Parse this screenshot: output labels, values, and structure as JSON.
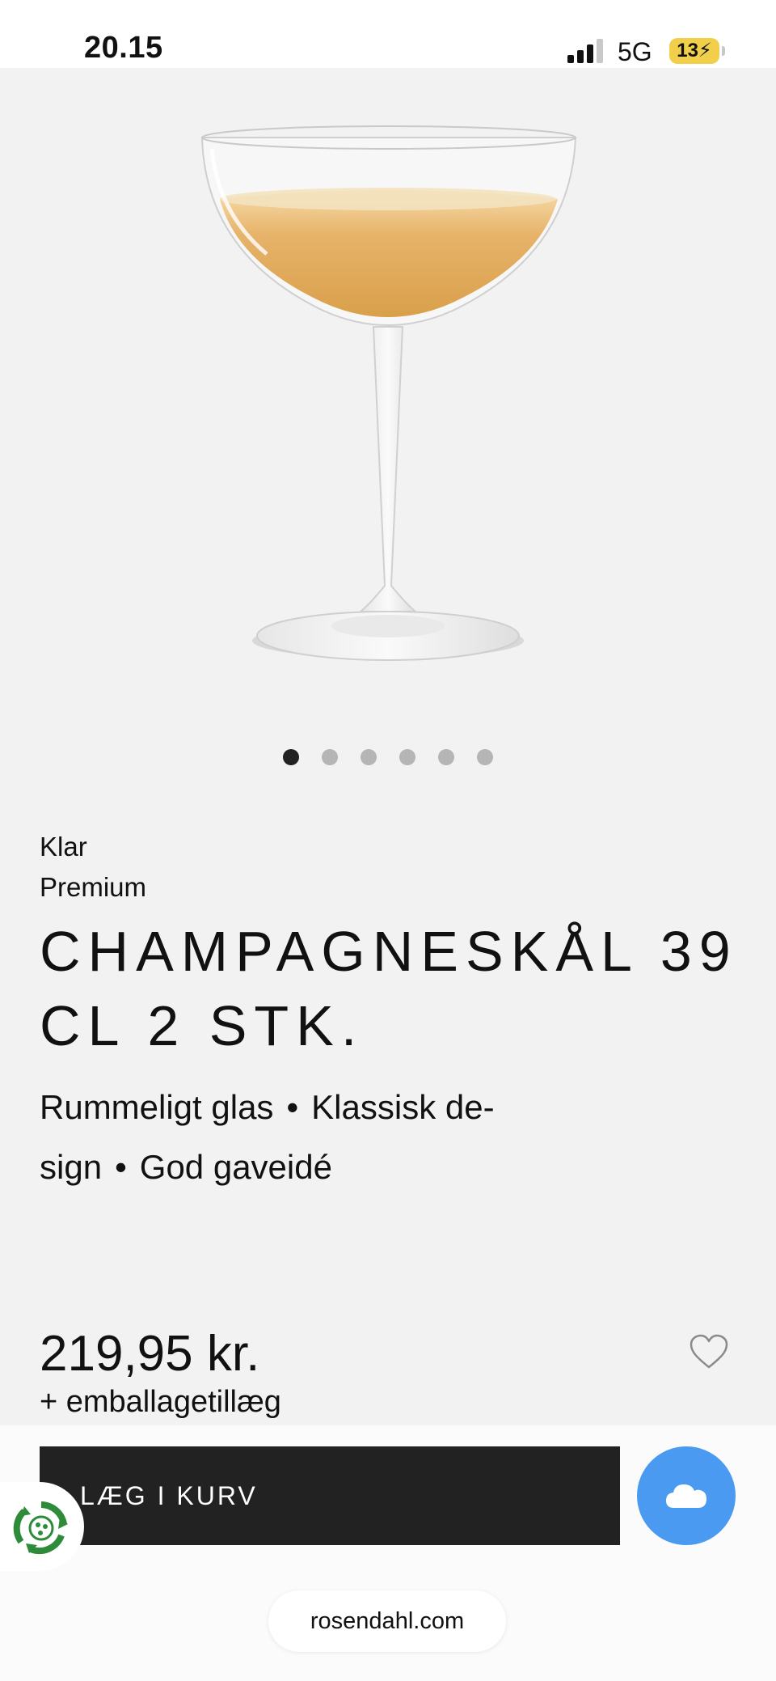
{
  "status_bar": {
    "time": "20.15",
    "network": "5G",
    "battery": "13"
  },
  "gallery": {
    "image_count": 6,
    "active_index": 0
  },
  "product": {
    "color": "Klar",
    "line": "Premium",
    "title": "CHAMPAGNESKÅL 39 CL 2 STK.",
    "features_row1": [
      "Rummeligt glas",
      "Klassisk de-"
    ],
    "features_row2": [
      "sign",
      "God gaveidé"
    ],
    "bullet": "•",
    "price": "219,95 kr.",
    "packaging_note": "+ emballagetillæg"
  },
  "actions": {
    "add_to_cart": "LÆG I KURV"
  },
  "browser": {
    "url": "rosendahl.com"
  },
  "colors": {
    "accent_blue": "#4a9af2",
    "cart_button": "#222222",
    "battery": "#f2cf4a"
  }
}
